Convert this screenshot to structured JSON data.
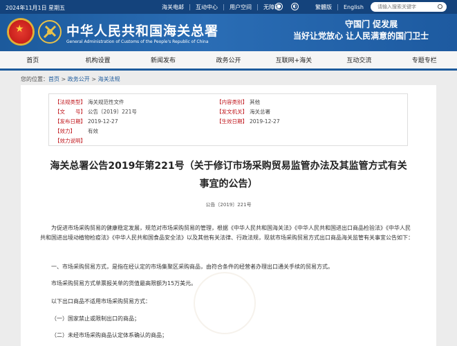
{
  "topbar": {
    "date": "2024年11月1日 星期五",
    "links": [
      "海关电邮",
      "互动中心",
      "用户空间",
      "无障碍"
    ],
    "social_icons": [
      "weibo-icon",
      "wechat-icon"
    ],
    "lang": [
      "繁體版",
      "English"
    ],
    "search_placeholder": "请输入搜索关键字"
  },
  "header": {
    "title_cn": "中华人民共和国海关总署",
    "title_en": "General Administration of Customs of the People's Republic of China",
    "slogan_line1": "守国门    促发展",
    "slogan_line2": "当好让党放心    让人民满意的国门卫士"
  },
  "nav": [
    "首页",
    "机构设置",
    "新闻发布",
    "政务公开",
    "互联网+海关",
    "互动交流",
    "专题专栏"
  ],
  "breadcrumb": {
    "prefix": "您的位置：",
    "items": [
      "首页",
      "政务公开",
      "海关法规"
    ],
    "sep": " > "
  },
  "meta": {
    "category_label": "【法规类型】",
    "category_value": "海关规范性文件",
    "content_label": "【内容类别】",
    "content_value": "其他",
    "docno_label": "【文　　号】",
    "docno_value": "公告〔2019〕221号",
    "issuer_label": "【发文机关】",
    "issuer_value": "海关总署",
    "pubdate_label": "【发布日期】",
    "pubdate_value": "2019-12-27",
    "effdate_label": "【生效日期】",
    "effdate_value": "2019-12-27",
    "status_label": "【效力】",
    "status_value": "有效",
    "note_label": "【效力说明】",
    "note_value": ""
  },
  "document": {
    "title_line1": "海关总署公告2019年第221号（关于修订市场采购贸易监管办法及其监管方式有关",
    "title_line2": "事宜的公告）",
    "number": "公告〔2019〕221号",
    "para1": "为促进市场采购贸易的健康稳定发展，规范对市场采购贸易的管理，根据《中华人民共和国海关法》《中华人民共和国进出口商品检验法》《中华人民共和国进出境动植物检疫法》《中华人民共和国食品安全法》以及其他有关法律、行政法规，现就市场采购贸易方式出口商品海关监管有关事宜公告如下：",
    "para2": "一、市场采购贸易方式，是指在经认定的市场集聚区采购商品，由符合条件的经营者办理出口通关手续的贸易方式。",
    "para3": "市场采购贸易方式单票报关单的货值最高限额为15万美元。",
    "para4": "以下出口商品不适用市场采购贸易方式：",
    "para5": "（一）国家禁止或限制出口的商品；",
    "para6": "（二）未经市场采购商品认定体系确认的商品；"
  }
}
